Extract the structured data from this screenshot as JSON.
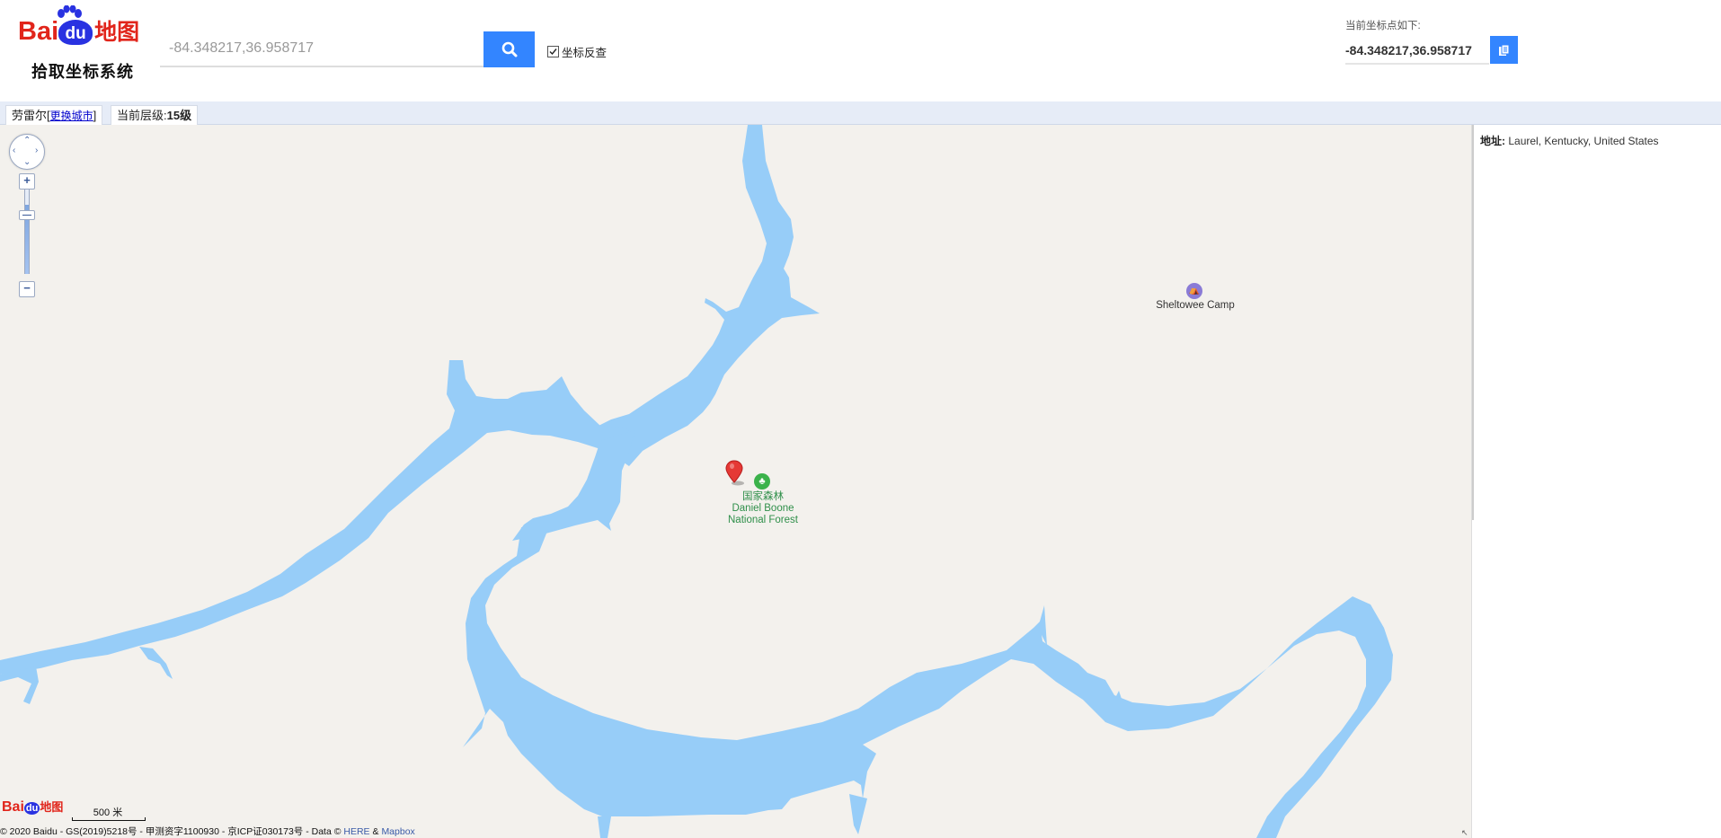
{
  "header": {
    "logo": {
      "brand_bai": "Bai",
      "brand_du": "du",
      "brand_ditu": "地图",
      "subtitle": "拾取坐标系统"
    },
    "search": {
      "value": "",
      "placeholder": "-84.348217,36.958717"
    },
    "reverse_lookup": {
      "label": "坐标反查",
      "checked": true
    },
    "coord": {
      "caption": "当前坐标点如下:",
      "value": "-84.348217,36.958717"
    }
  },
  "status_bar": {
    "city": "劳雷尔",
    "change_city": "更换城市",
    "bracket_open": "[",
    "bracket_close": "]",
    "zoom_level_label": "当前层级:",
    "zoom_level": "15级"
  },
  "map": {
    "pois": [
      {
        "name_cn": "国家森林",
        "name_en_1": "Daniel Boone",
        "name_en_2": "National Forest",
        "icon": "forest-icon",
        "color": "#3bb24a"
      },
      {
        "name": "Sheltowee Camp",
        "icon": "campsite-icon",
        "color": "#8a7bd6"
      }
    ],
    "water_color": "#97cdf8",
    "land_color": "#f3f1ed",
    "marker": {
      "icon": "location-pin-icon",
      "color": "#e53935"
    },
    "scale_label": "500 米",
    "logo": {
      "bai": "Bai",
      "du": "du",
      "ditu": "地图"
    },
    "copyright_prefix": "© 2020 Baidu - GS(2019)5218号 - 甲测资字1100930 - 京ICP证030173号 - Data ©",
    "copyright_here": "HERE",
    "copyright_amp": "&",
    "copyright_mapbox": "Mapbox"
  },
  "right_panel": {
    "address_label": "地址:",
    "address_value": "Laurel, Kentucky, United States"
  },
  "colors": {
    "accent": "#3385ff",
    "brand_red": "#e1251b",
    "brand_blue": "#2932e1"
  }
}
